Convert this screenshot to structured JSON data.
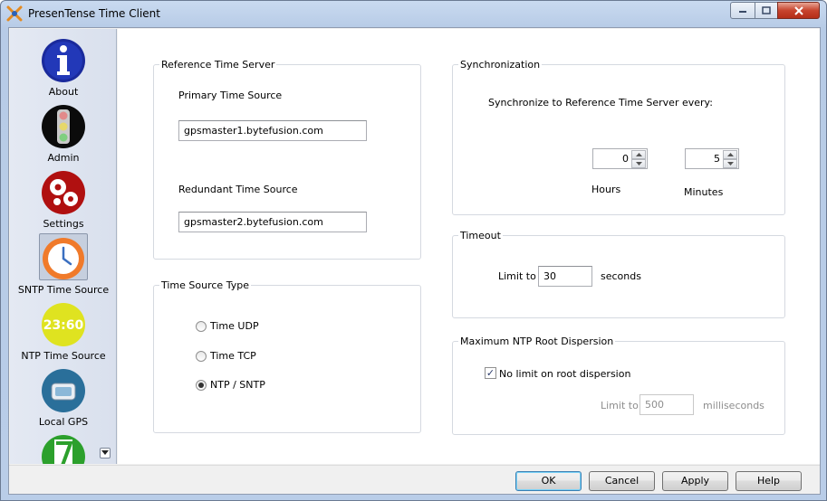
{
  "window": {
    "title": "PresenTense Time Client"
  },
  "sidebar": {
    "items": [
      {
        "label": "About",
        "icon": "info-icon"
      },
      {
        "label": "Admin",
        "icon": "traffic-light-icon"
      },
      {
        "label": "Settings",
        "icon": "gears-icon"
      },
      {
        "label": "SNTP Time Source",
        "icon": "clock-icon",
        "selected": true
      },
      {
        "label": "NTP Time Source",
        "icon": "digital-clock-icon",
        "display_text": "23:60"
      },
      {
        "label": "Local GPS",
        "icon": "gps-device-icon"
      },
      {
        "label": "",
        "icon": "timezone-icon"
      }
    ]
  },
  "reference": {
    "title": "Reference Time Server",
    "primary_label": "Primary Time Source",
    "primary_value": "gpsmaster1.bytefusion.com",
    "redundant_label": "Redundant Time Source",
    "redundant_value": "gpsmaster2.bytefusion.com"
  },
  "source_type": {
    "title": "Time Source Type",
    "options": [
      {
        "label": "Time UDP",
        "checked": false
      },
      {
        "label": "Time TCP",
        "checked": false
      },
      {
        "label": "NTP / SNTP",
        "checked": true
      }
    ]
  },
  "sync": {
    "title": "Synchronization",
    "text": "Synchronize to Reference Time Server every:",
    "hours_value": "0",
    "hours_label": "Hours",
    "minutes_value": "5",
    "minutes_label": "Minutes"
  },
  "timeout": {
    "title": "Timeout",
    "limit_label": "Limit to",
    "value": "30",
    "unit": "seconds"
  },
  "dispersion": {
    "title": "Maximum NTP Root Dispersion",
    "no_limit_label": "No limit on root dispersion",
    "no_limit_checked": true,
    "limit_label": "Limit to",
    "value": "500",
    "unit": "milliseconds"
  },
  "buttons": {
    "ok": "OK",
    "cancel": "Cancel",
    "apply": "Apply",
    "help": "Help"
  },
  "colors": {
    "accent": "#3c7fb1",
    "close": "#c7442e"
  }
}
